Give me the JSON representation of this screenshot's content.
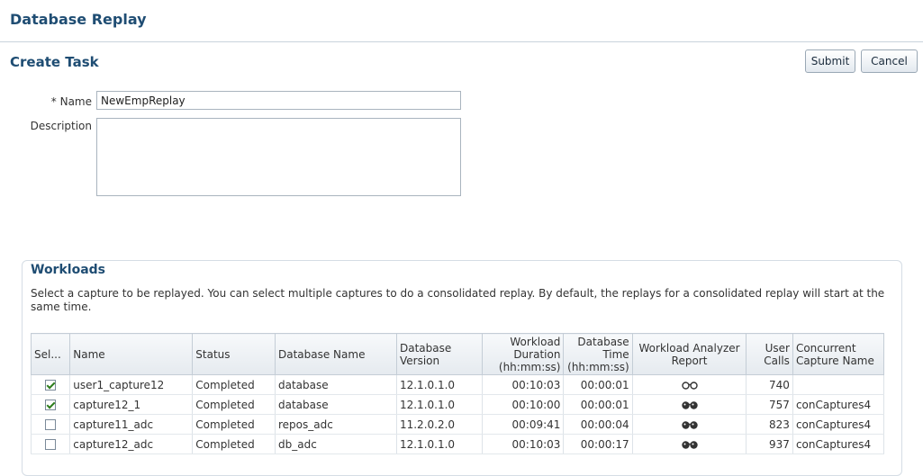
{
  "app": {
    "title": "Database Replay"
  },
  "page": {
    "title": "Create Task"
  },
  "toolbar": {
    "submit_label": "Submit",
    "cancel_label": "Cancel"
  },
  "form": {
    "name_label": "Name",
    "required_marker": "* ",
    "name_value": "NewEmpReplay",
    "description_label": "Description",
    "description_value": ""
  },
  "workloads": {
    "title": "Workloads",
    "description": "Select a capture to be replayed. You can select multiple captures to do a consolidated replay. By default, the replays for a consolidated replay will start at the same time.",
    "columns": [
      "Sel...",
      "Name",
      "Status",
      "Database Name",
      "Database Version",
      "Workload Duration (hh:mm:ss)",
      "Database Time (hh:mm:ss)",
      "Workload Analyzer Report",
      "User Calls",
      "Concurrent Capture Name"
    ],
    "rows": [
      {
        "selected": true,
        "name": "user1_capture12",
        "status": "Completed",
        "db_name": "database",
        "db_version": "12.1.0.1.0",
        "duration": "00:10:03",
        "db_time": "00:00:01",
        "report_icon": "glasses-outline-icon",
        "user_calls": "740",
        "concurrent": ""
      },
      {
        "selected": true,
        "name": "capture12_1",
        "status": "Completed",
        "db_name": "database",
        "db_version": "12.1.0.1.0",
        "duration": "00:10:00",
        "db_time": "00:00:01",
        "report_icon": "glasses-icon",
        "user_calls": "757",
        "concurrent": "conCaptures4"
      },
      {
        "selected": false,
        "name": "capture11_adc",
        "status": "Completed",
        "db_name": "repos_adc",
        "db_version": "11.2.0.2.0",
        "duration": "00:09:41",
        "db_time": "00:00:04",
        "report_icon": "glasses-icon",
        "user_calls": "823",
        "concurrent": "conCaptures4"
      },
      {
        "selected": false,
        "name": "capture12_adc",
        "status": "Completed",
        "db_name": "db_adc",
        "db_version": "12.1.0.1.0",
        "duration": "00:10:03",
        "db_time": "00:00:17",
        "report_icon": "glasses-icon",
        "user_calls": "937",
        "concurrent": "conCaptures4"
      }
    ]
  },
  "colors": {
    "heading": "#1f4d73",
    "check": "#2e7d1d"
  }
}
